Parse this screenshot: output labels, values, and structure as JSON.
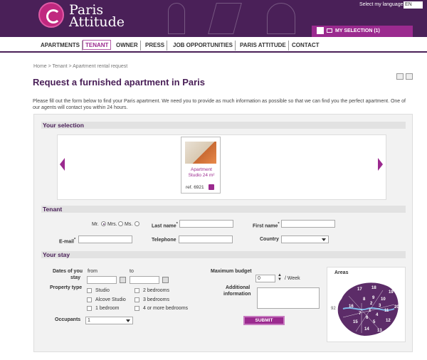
{
  "header": {
    "brand_line1": "Paris",
    "brand_line2": "Attitude",
    "language_label": "Select my language",
    "language_value": "EN",
    "my_selection": "MY SELECTION (1)"
  },
  "nav": {
    "items": [
      "APARTMENTS",
      "TENANT",
      "OWNER",
      "PRESS",
      "JOB OPPORTUNITIES",
      "PARIS ATTITUDE",
      "CONTACT"
    ],
    "active": "TENANT"
  },
  "breadcrumb": "Home > Tenant > Apartment rental request",
  "page": {
    "title": "Request a furnished apartment in Paris",
    "intro": "Please fill out the form below to find your Paris apartment. We need you to provide as much information as possible so that we can find you the perfect apartment. One of our agents will contact you within 24 hours."
  },
  "selection": {
    "heading": "Your selection",
    "card": {
      "type": "Apartment",
      "detail": "Studio 24 m²",
      "ref": "ref. 6921"
    }
  },
  "tenant": {
    "heading": "Tenant",
    "titles": [
      "Mr.",
      "Mrs.",
      "Ms."
    ],
    "selected_title": "Mrs.",
    "last_name": "Last name",
    "first_name": "First name",
    "email": "E-mail",
    "telephone": "Telephone",
    "country": "Country",
    "required_mark": "*"
  },
  "stay": {
    "heading": "Your stay",
    "dates_label_1": "Dates of you",
    "dates_label_2": "stay",
    "from": "from",
    "to": "to",
    "property_type": "Property type",
    "types_left": [
      "Studio",
      "Alcove Studio",
      "1 bedroom"
    ],
    "types_right": [
      "2 bedrooms",
      "3 bedrooms",
      "4 or more bedrooms"
    ],
    "occupants_label": "Occupants",
    "occupants_value": "1",
    "budget_label": "Maximum budget",
    "budget_value": "0",
    "budget_unit": "/ Week",
    "additional_1": "Additional",
    "additional_2": "information",
    "submit": "SUBMIT",
    "areas_title": "Areas",
    "areas_numbers": [
      "92",
      "17",
      "18",
      "19",
      "8",
      "9",
      "10",
      "16",
      "2",
      "3",
      "1",
      "11",
      "20",
      "7",
      "6",
      "4",
      "5",
      "15",
      "12",
      "14",
      "13"
    ]
  },
  "colors": {
    "brand_purple": "#4a2058",
    "accent_magenta": "#9b2a8f"
  }
}
